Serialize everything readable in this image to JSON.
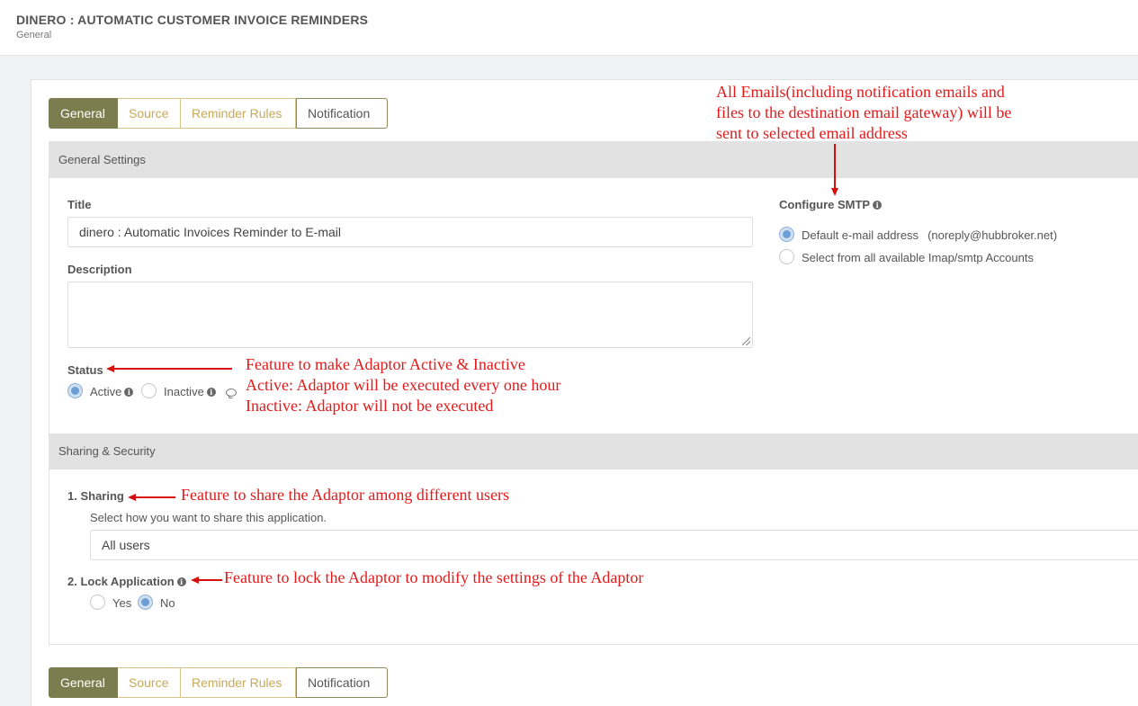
{
  "header": {
    "title": "DINERO : AUTOMATIC CUSTOMER INVOICE REMINDERS",
    "subtitle": "General"
  },
  "tabs": [
    "General",
    "Source",
    "Reminder Rules",
    "Notification"
  ],
  "general_settings": {
    "section_title": "General Settings",
    "title_label": "Title",
    "title_value": "dinero : Automatic Invoices Reminder to E-mail",
    "description_label": "Description",
    "description_value": "",
    "status_label": "Status",
    "status_options": [
      "Active",
      "Inactive"
    ],
    "status_selected": "Active"
  },
  "smtp": {
    "label": "Configure SMTP",
    "option_default": "Default e-mail address",
    "default_email": "(noreply@hubbroker.net)",
    "option_select": "Select from all available Imap/smtp Accounts",
    "selected": "Default e-mail address"
  },
  "sharing_security": {
    "section_title": "Sharing & Security",
    "sharing_label": "1. Sharing",
    "sharing_help": "Select how you want to share this application.",
    "sharing_value": "All users",
    "lock_label": "2. Lock Application",
    "lock_options": [
      "Yes",
      "No"
    ],
    "lock_selected": "No"
  },
  "annotations": {
    "smtp_note": [
      "All Emails(including notification emails and",
      "files to the destination email gateway) will be",
      "sent to selected email address"
    ],
    "status_note": [
      "Feature to make Adaptor Active & Inactive",
      "Active: Adaptor will be executed every one hour",
      "Inactive: Adaptor will not be executed"
    ],
    "sharing_note": "Feature to share the Adaptor among different users",
    "lock_note": "Feature to lock the Adaptor to modify the settings of the Adaptor"
  },
  "colors": {
    "tab_active_bg": "#7c7d4e",
    "tab_inactive_text": "#c8a95a",
    "annotation": "#e21a1a",
    "radio_selected": "#6d9fd6"
  }
}
